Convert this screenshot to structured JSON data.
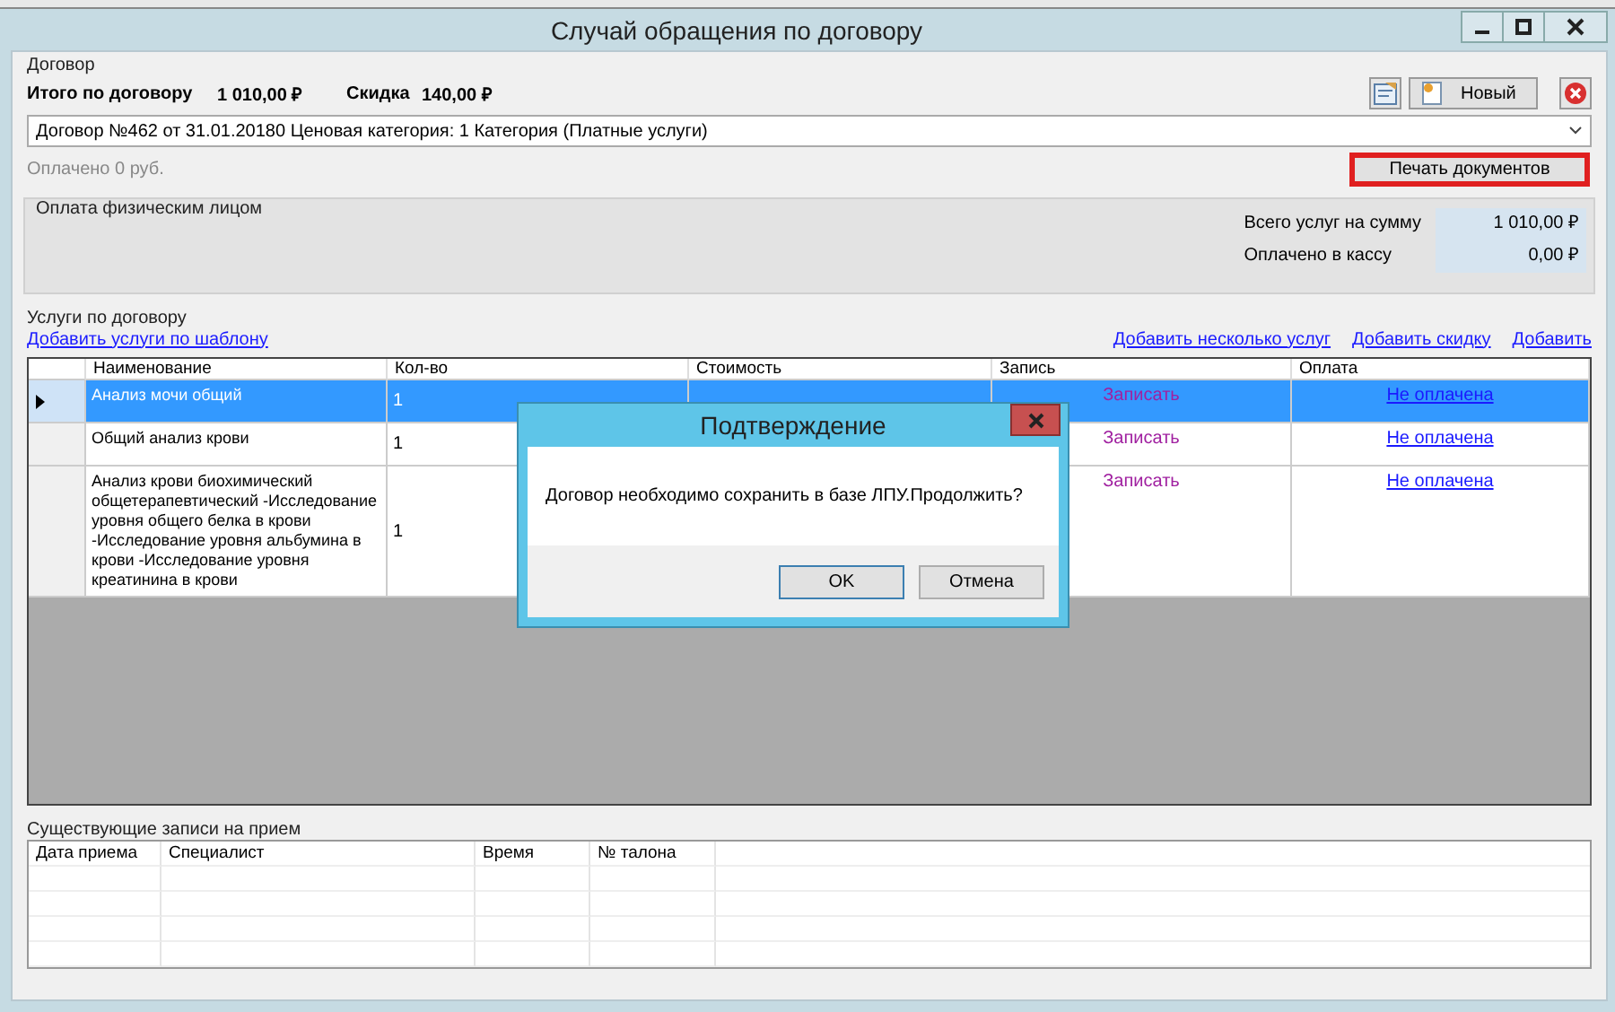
{
  "window": {
    "title": "Случай обращения по договору"
  },
  "contract": {
    "group_title": "Договор",
    "total_label": "Итого по договору",
    "total_value": "1 010,00 ₽",
    "discount_label": "Скидка",
    "discount_value": "140,00 ₽",
    "new_button": "Новый",
    "contract_select": "Договор №462 от 31.01.20180 Ценовая категория: 1 Категория (Платные услуги)",
    "paid_note": "Оплачено 0 руб.",
    "print_button": "Печать документов"
  },
  "payment": {
    "group_title": "Оплата физическим лицом",
    "summary": [
      {
        "label": "Всего услуг на сумму",
        "value": "1 010,00 ₽"
      },
      {
        "label": "Оплачено в кассу",
        "value": "0,00 ₽"
      }
    ]
  },
  "services": {
    "group_title": "Услуги по договору",
    "template_link": "Добавить услуги по шаблону",
    "links": [
      "Добавить несколько услуг",
      "Добавить скидку",
      "Добавить"
    ],
    "columns": [
      "Наименование",
      "Кол-во",
      "Стоимость",
      "Запись",
      "Оплата"
    ],
    "rows": [
      {
        "selected": true,
        "name": "Анализ мочи общий",
        "qty": "1",
        "record": "Записать",
        "payment": "Не оплачена"
      },
      {
        "selected": false,
        "name": "Общий  анализ крови",
        "qty": "1",
        "record": "Записать",
        "payment": "Не оплачена"
      },
      {
        "selected": false,
        "name": "Анализ крови биохимический общетерапевтический -Исследование уровня общего белка в крови -Исследование уровня альбумина в крови -Исследование уровня креатинина в крови",
        "qty": "1",
        "record": "Записать",
        "payment": "Не оплачена"
      }
    ]
  },
  "appointments": {
    "group_title": "Существующие записи на прием",
    "columns": [
      "Дата приема",
      "Специалист",
      "Время",
      "№ талона"
    ]
  },
  "dialog": {
    "title": "Подтверждение",
    "message": "Договор необходимо сохранить в базе ЛПУ.Продолжить?",
    "buttons": [
      "OK",
      "Отмена"
    ]
  }
}
